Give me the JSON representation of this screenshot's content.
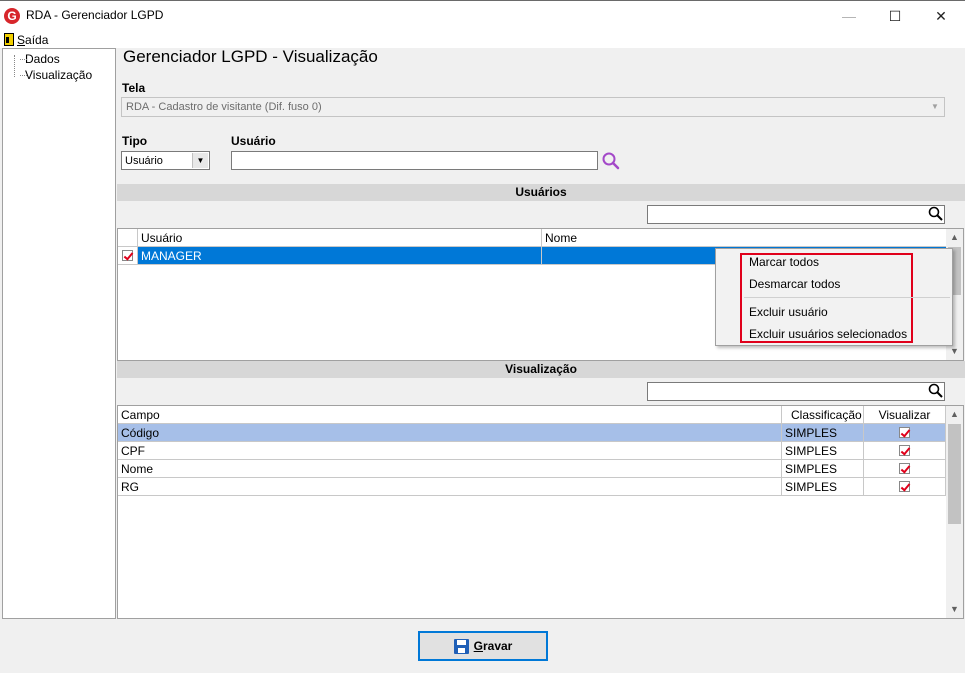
{
  "window": {
    "title": "RDA - Gerenciador LGPD",
    "app_icon": "G",
    "controls": {
      "minimize": "—",
      "maximize": "☐",
      "close": "✕"
    }
  },
  "menu": {
    "exit_label_u": "S",
    "exit_label_rest": "aída"
  },
  "tree": {
    "items": [
      {
        "label": "Dados"
      },
      {
        "label": "Visualização"
      }
    ]
  },
  "page_title": "Gerenciador LGPD - Visualização",
  "tela": {
    "label": "Tela",
    "value": "RDA - Cadastro de visitante (Dif. fuso 0)"
  },
  "tipo": {
    "label": "Tipo",
    "value": "Usuário"
  },
  "usuario": {
    "label": "Usuário",
    "value": ""
  },
  "users_section": {
    "header": "Usuários",
    "search_value": "",
    "columns": [
      "Usuário",
      "Nome"
    ],
    "rows": [
      {
        "checked": true,
        "usuario": "MANAGER",
        "nome": ""
      }
    ]
  },
  "context_menu": {
    "items": [
      "Marcar todos",
      "Desmarcar todos",
      "Excluir usuário",
      "Excluir usuários selecionados"
    ]
  },
  "fields_section": {
    "header": "Visualização",
    "search_value": "",
    "columns": [
      "Campo",
      "Classificação",
      "Visualizar"
    ],
    "rows": [
      {
        "campo": "Código",
        "classificacao": "SIMPLES",
        "visualizar": true
      },
      {
        "campo": "CPF",
        "classificacao": "SIMPLES",
        "visualizar": true
      },
      {
        "campo": "Nome",
        "classificacao": "SIMPLES",
        "visualizar": true
      },
      {
        "campo": "RG",
        "classificacao": "SIMPLES",
        "visualizar": true
      }
    ]
  },
  "save_button": {
    "label_u": "G",
    "label_rest": "ravar"
  },
  "colors": {
    "selection": "#0078d7",
    "row_highlight": "#a6bfe8",
    "accent_red": "#e0001b",
    "brand": "#d7262b"
  }
}
